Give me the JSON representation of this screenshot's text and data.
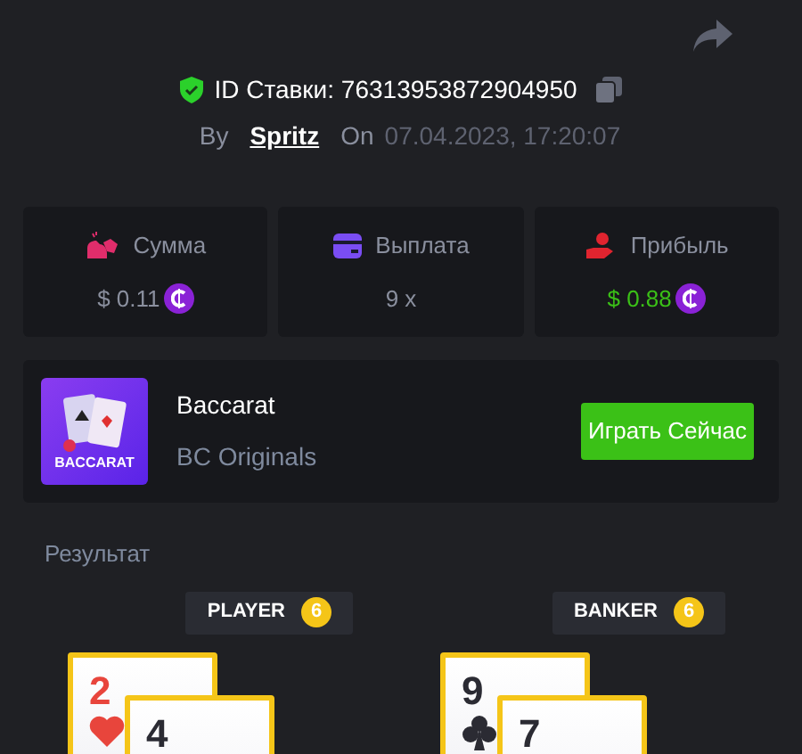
{
  "bet_id": {
    "label": "ID Ставки:",
    "value": "76313953872904950"
  },
  "byline": {
    "by": "By",
    "user": "Spritz",
    "on": "On",
    "date": "07.04.2023, 17:20:07"
  },
  "stats": [
    {
      "kind": "amount",
      "label": "Сумма",
      "value": "$ 0.11",
      "coin": true,
      "positive": false
    },
    {
      "kind": "payout",
      "label": "Выплата",
      "value": "9 x",
      "coin": false,
      "positive": false
    },
    {
      "kind": "profit",
      "label": "Прибыль",
      "value": "$ 0.88",
      "coin": true,
      "positive": true
    }
  ],
  "game": {
    "badge": "BACCARAT",
    "title": "Baccarat",
    "provider": "BC Originals",
    "button": "Играть Сейчас"
  },
  "result": {
    "title": "Результат",
    "hands": [
      {
        "label": "PLAYER",
        "score": "6",
        "cards": [
          {
            "rank": "2",
            "kind": "hearts"
          },
          {
            "rank": "4"
          }
        ]
      },
      {
        "label": "BANKER",
        "score": "6",
        "cards": [
          {
            "rank": "9",
            "kind": "clubs"
          },
          {
            "rank": "7"
          }
        ]
      }
    ]
  }
}
